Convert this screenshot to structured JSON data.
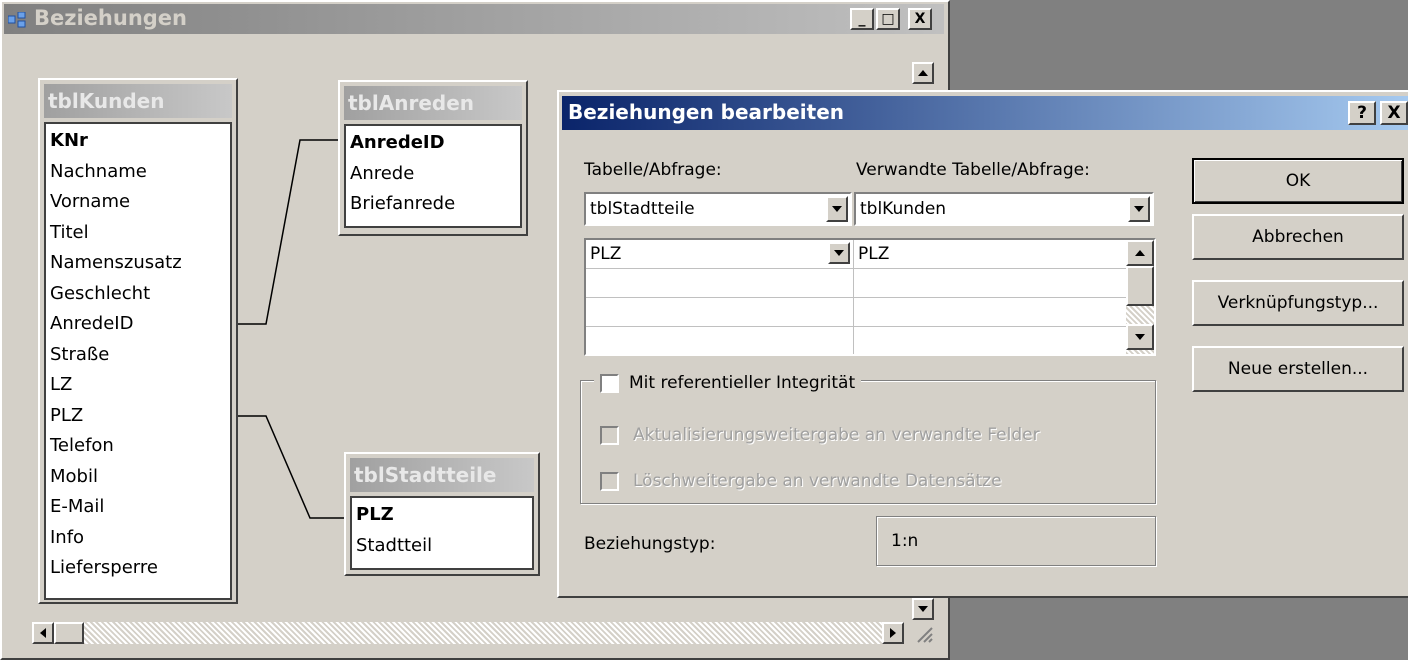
{
  "relationships_window": {
    "title": "Beziehungen",
    "buttons": {
      "minimize": "_",
      "maximize": "□",
      "close": "X"
    },
    "tables": [
      {
        "name": "tblKunden",
        "fields": [
          {
            "label": "KNr",
            "key": true
          },
          {
            "label": "Nachname",
            "key": false
          },
          {
            "label": "Vorname",
            "key": false
          },
          {
            "label": "Titel",
            "key": false
          },
          {
            "label": "Namenszusatz",
            "key": false
          },
          {
            "label": "Geschlecht",
            "key": false
          },
          {
            "label": "AnredeID",
            "key": false
          },
          {
            "label": "Straße",
            "key": false
          },
          {
            "label": "LZ",
            "key": false
          },
          {
            "label": "PLZ",
            "key": false
          },
          {
            "label": "Telefon",
            "key": false
          },
          {
            "label": "Mobil",
            "key": false
          },
          {
            "label": "E-Mail",
            "key": false
          },
          {
            "label": "Info",
            "key": false
          },
          {
            "label": "Liefersperre",
            "key": false
          }
        ]
      },
      {
        "name": "tblAnreden",
        "fields": [
          {
            "label": "AnredeID",
            "key": true
          },
          {
            "label": "Anrede",
            "key": false
          },
          {
            "label": "Briefanrede",
            "key": false
          }
        ]
      },
      {
        "name": "tblStadtteile",
        "fields": [
          {
            "label": "PLZ",
            "key": true
          },
          {
            "label": "Stadtteil",
            "key": false
          }
        ]
      }
    ]
  },
  "dialog": {
    "title": "Beziehungen bearbeiten",
    "title_buttons": {
      "help": "?",
      "close": "X"
    },
    "table_label": "Tabelle/Abfrage:",
    "related_table_label": "Verwandte Tabelle/Abfrage:",
    "table_value": "tblStadtteile",
    "related_table_value": "tblKunden",
    "field_grid": [
      {
        "left": "PLZ",
        "right": "PLZ"
      },
      {
        "left": "",
        "right": ""
      },
      {
        "left": "",
        "right": ""
      },
      {
        "left": "",
        "right": ""
      }
    ],
    "referential_integrity": {
      "label": "Mit referentieller Integrität",
      "checked": false
    },
    "cascade_update": {
      "label": "Aktualisierungsweitergabe an verwandte Felder",
      "checked": false,
      "disabled": true
    },
    "cascade_delete": {
      "label": "Löschweitergabe an verwandte Datensätze",
      "checked": false,
      "disabled": true
    },
    "relationship_type_label": "Beziehungstyp:",
    "relationship_type_value": "1:n",
    "buttons": {
      "ok": "OK",
      "cancel": "Abbrechen",
      "join_type": "Verknüpfungstyp...",
      "create_new": "Neue erstellen..."
    }
  },
  "colors": {
    "face": "#d4d0c8",
    "dialog_title_start": "#0a246a",
    "dialog_title_end": "#a6caf0",
    "inactive_title_start": "#808080",
    "inactive_title_end": "#c0c0c0"
  }
}
